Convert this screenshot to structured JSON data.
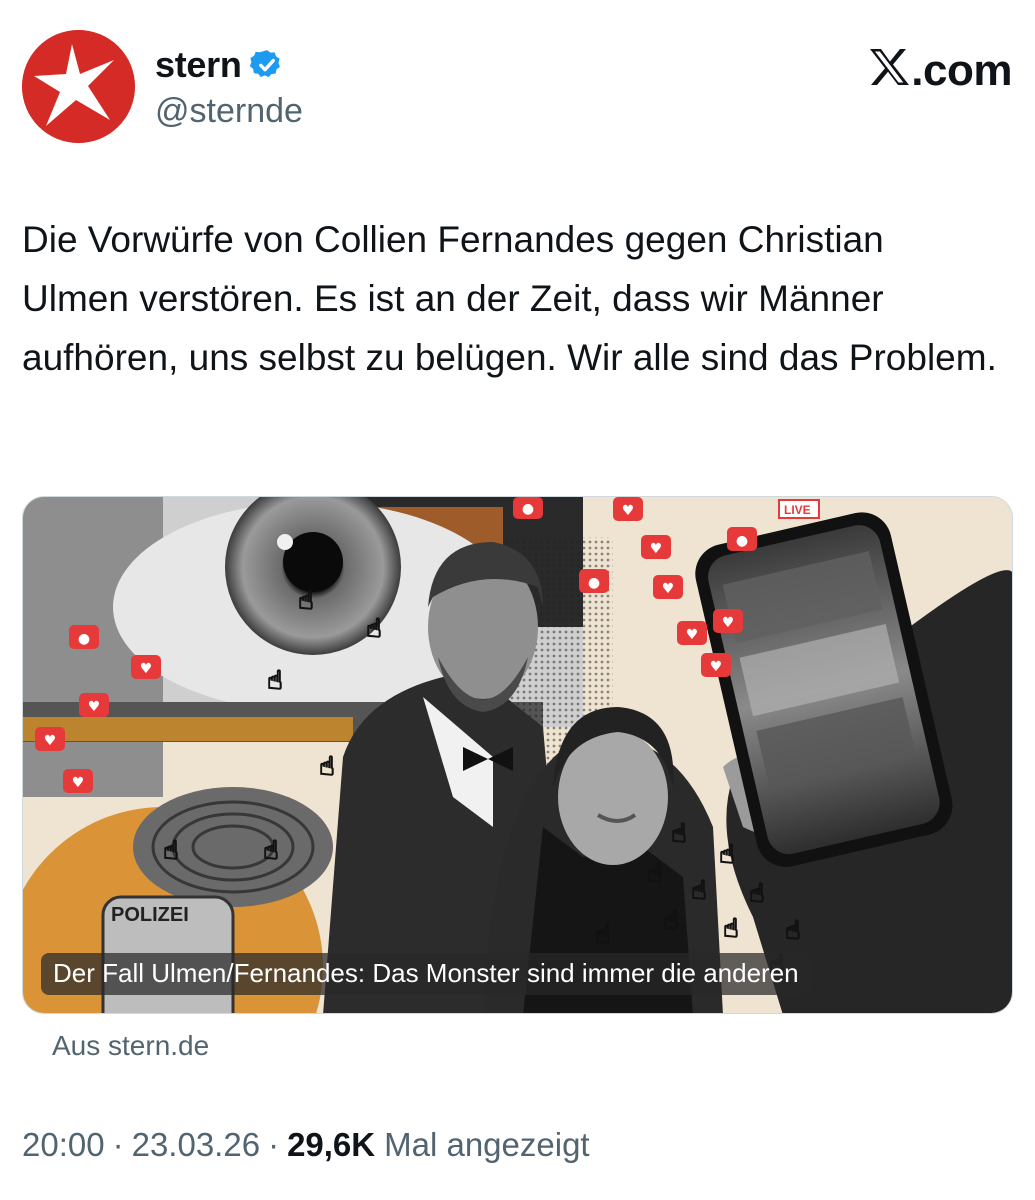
{
  "account": {
    "display_name": "stern",
    "handle": "@sternde",
    "verified": true,
    "avatar_icon": "stern-star-logo-icon",
    "avatar_color": "#d52b26"
  },
  "platform": {
    "label": ".com",
    "logo": "x-logo-icon"
  },
  "tweet": {
    "text": "Die Vorwürfe von Collien Fernandes gegen Christian Ulmen verstören. Es ist an der Zeit, dass wir Männer aufhören, uns selbst zu belügen. Wir alle sind das Problem."
  },
  "card": {
    "caption": "Der Fall Ulmen/Fernandes: Das Monster sind immer die anderen",
    "source": "Aus stern.de",
    "image_texts": {
      "live_badge": "LIVE",
      "police_badge": "POLIZEI"
    }
  },
  "meta": {
    "time": "20:00",
    "date": "23.03.26",
    "views_count": "29,6K",
    "views_label": "Mal angezeigt"
  },
  "colors": {
    "text_primary": "#0f1419",
    "text_secondary": "#536471",
    "verified_blue": "#1d9bf0",
    "notification_red": "#e63a3a"
  }
}
